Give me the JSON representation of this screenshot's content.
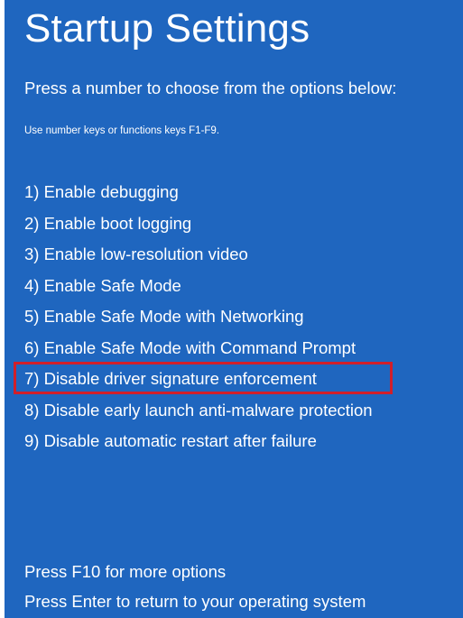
{
  "screen": {
    "title": "Startup Settings",
    "subtitle": "Press a number to choose from the options below:",
    "hint": "Use number keys or functions keys F1-F9.",
    "options": [
      "1) Enable debugging",
      "2) Enable boot logging",
      "3) Enable low-resolution video",
      "4) Enable Safe Mode",
      "5) Enable Safe Mode with Networking",
      "6) Enable Safe Mode with Command Prompt",
      "7) Disable driver signature enforcement",
      "8) Disable early launch anti-malware protection",
      "9) Disable automatic restart after failure"
    ],
    "footer_more": "Press F10 for more options",
    "footer_return": "Press Enter to return to your operating system"
  },
  "colors": {
    "background": "#1f66bf",
    "text": "#ffffff",
    "highlight": "#d11f2a"
  }
}
